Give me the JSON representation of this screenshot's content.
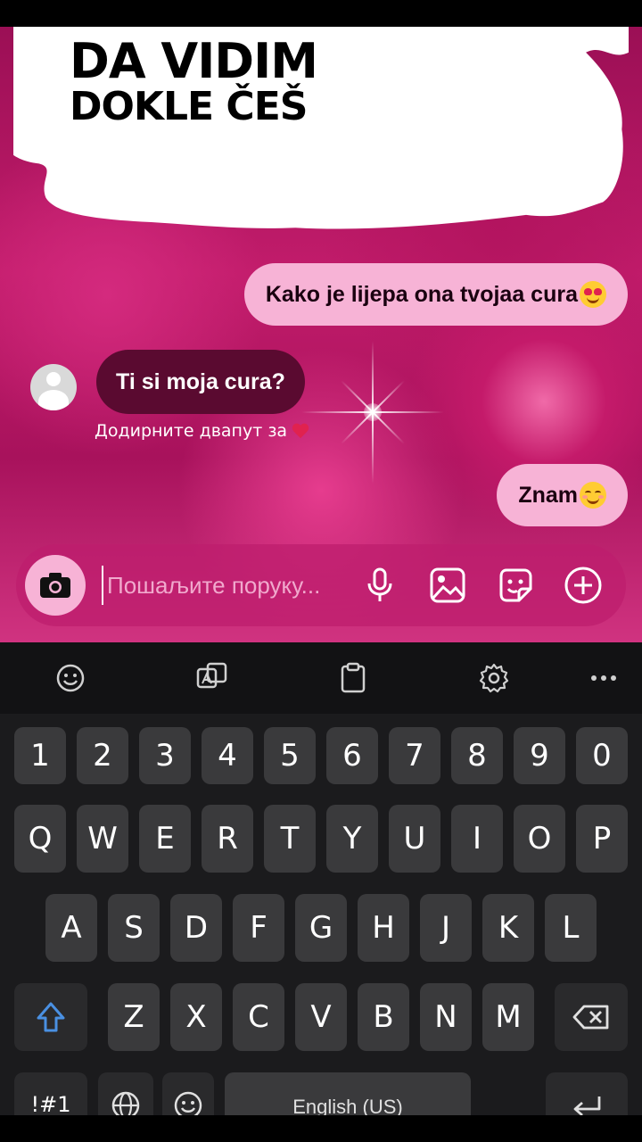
{
  "overlay": {
    "line1": "DA VIDIM",
    "line2": "DOKLE ČEŠ"
  },
  "messages": [
    {
      "side": "out",
      "text": "Kako je lijepa ona tvojaa cura",
      "emoji": "heart-eyes-emoji"
    },
    {
      "side": "in",
      "text": "Ti si moja cura?"
    },
    {
      "side": "out",
      "text": "Znam",
      "emoji": "smiling-blush-emoji"
    }
  ],
  "hint": {
    "text": "Додирните двапут за",
    "icon": "heart-icon"
  },
  "composer": {
    "placeholder": "Пошаљите поруку...",
    "icons": [
      "camera-icon",
      "microphone-icon",
      "image-icon",
      "sticker-icon",
      "plus-icon"
    ]
  },
  "colors": {
    "outgoing_bubble": "#f7b3d6",
    "incoming_bubble": "#5a0a30",
    "keyboard_bg": "#1b1b1d",
    "key_bg": "#3a3a3c",
    "accent_blue": "#4a90e2"
  },
  "keyboard": {
    "toolbar": [
      "emoji-icon",
      "translate-icon",
      "clipboard-icon",
      "settings-icon",
      "more-icon"
    ],
    "row_numbers": [
      "1",
      "2",
      "3",
      "4",
      "5",
      "6",
      "7",
      "8",
      "9",
      "0"
    ],
    "row1": [
      "Q",
      "W",
      "E",
      "R",
      "T",
      "Y",
      "U",
      "I",
      "O",
      "P"
    ],
    "row2": [
      "A",
      "S",
      "D",
      "F",
      "G",
      "H",
      "J",
      "K",
      "L"
    ],
    "row3": [
      "Z",
      "X",
      "C",
      "V",
      "B",
      "N",
      "M"
    ],
    "symbols_label": "!#1",
    "space_label": "English (US)"
  }
}
